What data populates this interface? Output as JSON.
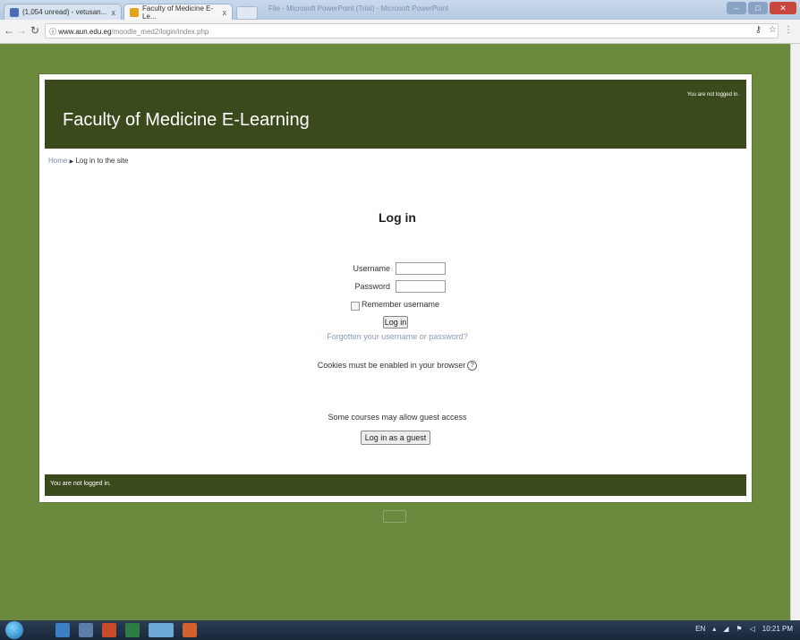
{
  "browser": {
    "tabs": [
      {
        "label": "(1,054 unread) - vetusan...",
        "close": "x"
      },
      {
        "label": "Faculty of Medicine E-Le...",
        "close": "x"
      }
    ],
    "window_caption": "File - Microsoft PowerPoint (Trial) - Microsoft PowerPoint",
    "url_domain": "www.aun.edu.eg",
    "url_path": "/moodle_med2/login/index.php"
  },
  "site": {
    "title": "Faculty of Medicine E-Learning",
    "login_status_top": "You are not logged in.",
    "login_status_bottom": "You are not logged in."
  },
  "breadcrumb": {
    "home": "Home",
    "separator": "▶",
    "current": "Log in to the site"
  },
  "login": {
    "heading": "Log in",
    "username_label": "Username",
    "password_label": "Password",
    "remember_label": "Remember username",
    "submit_label": "Log in",
    "forgot_link": "Forgotten your username or password?",
    "cookies_text": "Cookies must be enabled in your browser",
    "help_symbol": "?",
    "guest_info": "Some courses may allow guest access",
    "guest_button": "Log in as a guest"
  },
  "taskbar": {
    "lang": "EN",
    "time": "10:21 PM"
  },
  "colors": {
    "page_bg": "#6b8a3e",
    "header_bg": "#3b4a1c",
    "link": "#8a9ab0"
  }
}
